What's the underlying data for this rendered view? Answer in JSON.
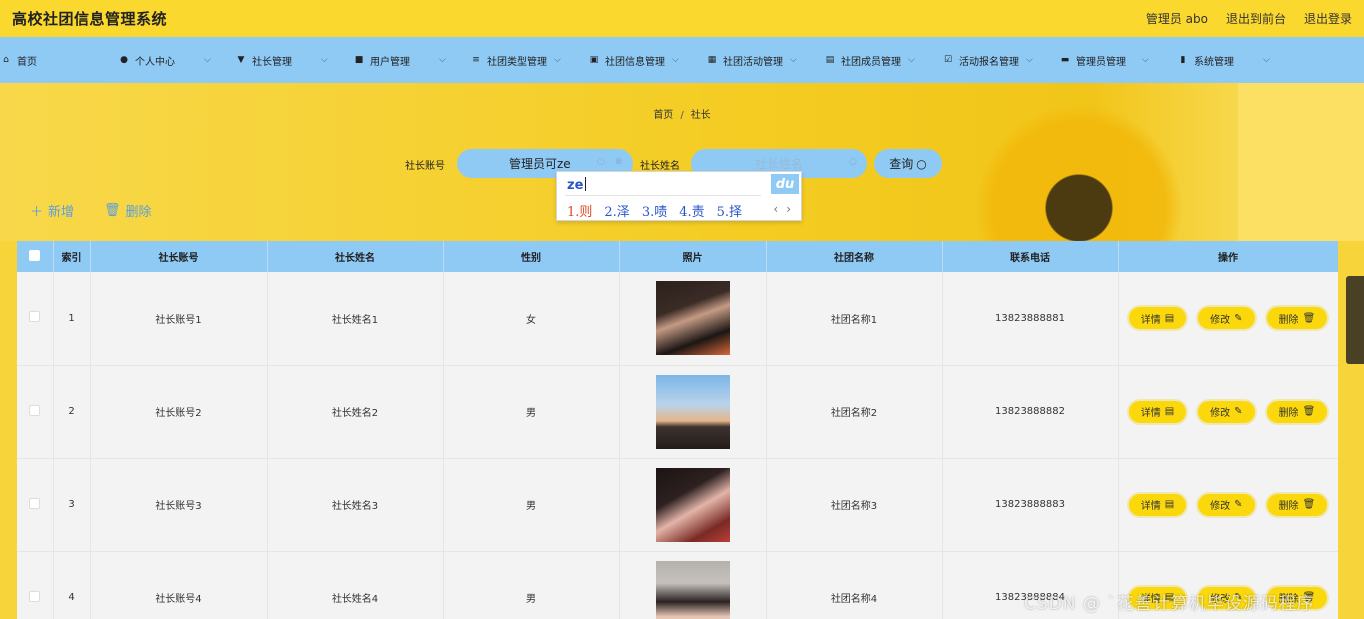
{
  "header": {
    "app_title": "高校社团信息管理系统",
    "user_label": "管理员 abo",
    "front_link": "退出到前台",
    "logout_link": "退出登录"
  },
  "nav": {
    "items": [
      {
        "label": "首页",
        "icon": "home-icon",
        "glyph": "⌂",
        "dropdown": false
      },
      {
        "label": "个人中心",
        "icon": "user-icon",
        "glyph": "●",
        "dropdown": true
      },
      {
        "label": "社长管理",
        "icon": "president-icon",
        "glyph": "▼",
        "dropdown": true
      },
      {
        "label": "用户管理",
        "icon": "briefcase-icon",
        "glyph": "■",
        "dropdown": true
      },
      {
        "label": "社团类型管理",
        "icon": "sliders-icon",
        "glyph": "≡",
        "dropdown": true
      },
      {
        "label": "社团信息管理",
        "icon": "film-icon",
        "glyph": "▣",
        "dropdown": true
      },
      {
        "label": "社团活动管理",
        "icon": "grid-icon",
        "glyph": "▦",
        "dropdown": true
      },
      {
        "label": "社团成员管理",
        "icon": "clipboard-icon",
        "glyph": "▤",
        "dropdown": true
      },
      {
        "label": "活动报名管理",
        "icon": "check-square-icon",
        "glyph": "☑",
        "dropdown": true
      },
      {
        "label": "管理员管理",
        "icon": "admin-icon",
        "glyph": "▬",
        "dropdown": true
      },
      {
        "label": "系统管理",
        "icon": "bar-chart-icon",
        "glyph": "▮",
        "dropdown": true
      }
    ]
  },
  "breadcrumb": {
    "home": "首页",
    "separator": "/",
    "current": "社长"
  },
  "search": {
    "account_label": "社长账号",
    "account_value": "管理员可ze",
    "name_label": "社长姓名",
    "name_placeholder": "社长姓名",
    "query_label": "查询"
  },
  "ime": {
    "composition": "ze",
    "candidates": [
      "1.则",
      "2.泽",
      "3.啧",
      "4.责",
      "5.择"
    ],
    "logo": "du"
  },
  "actions": {
    "add_label": "新增",
    "delete_label": "删除"
  },
  "table": {
    "headers": [
      "索引",
      "社长账号",
      "社长姓名",
      "性别",
      "照片",
      "社团名称",
      "联系电话",
      "操作"
    ],
    "rows": [
      {
        "index": "1",
        "account": "社长账号1",
        "name": "社长姓名1",
        "gender": "女",
        "club": "社团名称1",
        "phone": "13823888881"
      },
      {
        "index": "2",
        "account": "社长账号2",
        "name": "社长姓名2",
        "gender": "男",
        "club": "社团名称2",
        "phone": "13823888882"
      },
      {
        "index": "3",
        "account": "社长账号3",
        "name": "社长姓名3",
        "gender": "男",
        "club": "社团名称3",
        "phone": "13823888883"
      },
      {
        "index": "4",
        "account": "社长账号4",
        "name": "社长姓名4",
        "gender": "男",
        "club": "社团名称4",
        "phone": "13823888884"
      }
    ],
    "row_buttons": {
      "detail": "详情",
      "edit": "修改",
      "delete": "删除"
    }
  },
  "watermark": "CSDN @ `花善计算机毕设源码程序"
}
